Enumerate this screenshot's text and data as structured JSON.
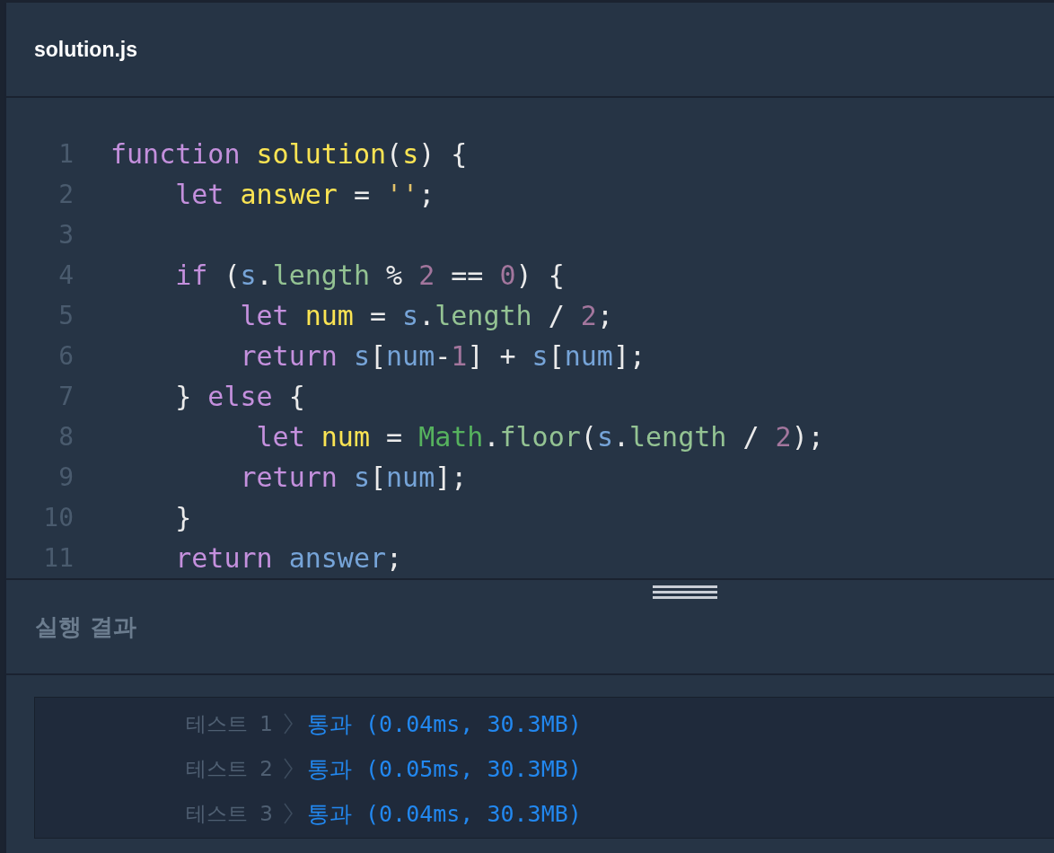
{
  "file_tab": {
    "title": "solution.js"
  },
  "code": {
    "lines": [
      {
        "number": "1",
        "tokens": [
          {
            "kind": "keyword",
            "text": "function"
          },
          {
            "kind": "name",
            "text": " solution"
          },
          {
            "kind": "punct",
            "text": "("
          },
          {
            "kind": "name",
            "text": "s"
          },
          {
            "kind": "punct",
            "text": ") {"
          }
        ]
      },
      {
        "number": "2",
        "tokens": [
          {
            "kind": "keyword",
            "text": "    let"
          },
          {
            "kind": "name",
            "text": " answer"
          },
          {
            "kind": "punct",
            "text": " ="
          },
          {
            "kind": "string",
            "text": " ''"
          },
          {
            "kind": "punct",
            "text": ";"
          }
        ]
      },
      {
        "number": "3"
      },
      {
        "number": "4",
        "tokens": [
          {
            "kind": "keyword",
            "text": "    if"
          },
          {
            "kind": "punct",
            "text": " ("
          },
          {
            "kind": "variable",
            "text": "s"
          },
          {
            "kind": "punct",
            "text": "."
          },
          {
            "kind": "property",
            "text": "length"
          },
          {
            "kind": "punct",
            "text": " %"
          },
          {
            "kind": "number",
            "text": " 2"
          },
          {
            "kind": "punct",
            "text": " =="
          },
          {
            "kind": "number",
            "text": " 0"
          },
          {
            "kind": "punct",
            "text": ") {"
          }
        ]
      },
      {
        "number": "5",
        "tokens": [
          {
            "kind": "keyword",
            "text": "        let"
          },
          {
            "kind": "name",
            "text": " num"
          },
          {
            "kind": "punct",
            "text": " ="
          },
          {
            "kind": "variable",
            "text": " s"
          },
          {
            "kind": "punct",
            "text": "."
          },
          {
            "kind": "property",
            "text": "length"
          },
          {
            "kind": "punct",
            "text": " /"
          },
          {
            "kind": "number",
            "text": " 2"
          },
          {
            "kind": "punct",
            "text": ";"
          }
        ]
      },
      {
        "number": "6",
        "tokens": [
          {
            "kind": "keyword",
            "text": "        return"
          },
          {
            "kind": "variable",
            "text": " s"
          },
          {
            "kind": "punct",
            "text": "["
          },
          {
            "kind": "variable",
            "text": "num"
          },
          {
            "kind": "punct",
            "text": "-"
          },
          {
            "kind": "number",
            "text": "1"
          },
          {
            "kind": "punct",
            "text": "] +"
          },
          {
            "kind": "variable",
            "text": " s"
          },
          {
            "kind": "punct",
            "text": "["
          },
          {
            "kind": "variable",
            "text": "num"
          },
          {
            "kind": "punct",
            "text": "];"
          }
        ]
      },
      {
        "number": "7",
        "tokens": [
          {
            "kind": "punct",
            "text": "    }"
          },
          {
            "kind": "keyword",
            "text": " else"
          },
          {
            "kind": "punct",
            "text": " {"
          }
        ]
      },
      {
        "number": "8",
        "tokens": [
          {
            "kind": "keyword",
            "text": "         let"
          },
          {
            "kind": "name",
            "text": " num"
          },
          {
            "kind": "punct",
            "text": " ="
          },
          {
            "kind": "builtin",
            "text": " Math"
          },
          {
            "kind": "punct",
            "text": "."
          },
          {
            "kind": "property",
            "text": "floor"
          },
          {
            "kind": "punct",
            "text": "("
          },
          {
            "kind": "variable",
            "text": "s"
          },
          {
            "kind": "punct",
            "text": "."
          },
          {
            "kind": "property",
            "text": "length"
          },
          {
            "kind": "punct",
            "text": " /"
          },
          {
            "kind": "number",
            "text": " 2"
          },
          {
            "kind": "punct",
            "text": ");"
          }
        ]
      },
      {
        "number": "9",
        "tokens": [
          {
            "kind": "keyword",
            "text": "        return"
          },
          {
            "kind": "variable",
            "text": " s"
          },
          {
            "kind": "punct",
            "text": "["
          },
          {
            "kind": "variable",
            "text": "num"
          },
          {
            "kind": "punct",
            "text": "];"
          }
        ]
      },
      {
        "number": "10",
        "tokens": [
          {
            "kind": "punct",
            "text": "    }"
          }
        ]
      },
      {
        "number": "11",
        "tokens": [
          {
            "kind": "keyword",
            "text": "    return"
          },
          {
            "kind": "variable",
            "text": " answer"
          },
          {
            "kind": "punct",
            "text": ";"
          }
        ]
      }
    ]
  },
  "results": {
    "title": "실행 결과",
    "tests": [
      {
        "label": "테스트 1",
        "result": "통과 (0.04ms, 30.3MB)",
        "passed": true
      },
      {
        "label": "테스트 2",
        "result": "통과 (0.05ms, 30.3MB)",
        "passed": true
      },
      {
        "label": "테스트 3",
        "result": "통과 (0.04ms, 30.3MB)",
        "passed": true
      }
    ]
  }
}
